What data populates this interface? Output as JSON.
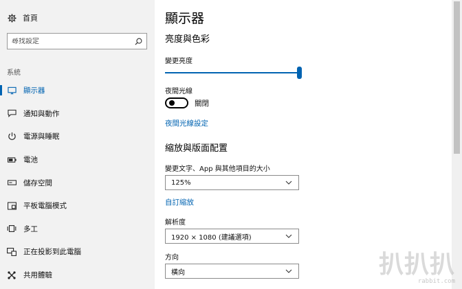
{
  "sidebar": {
    "home_label": "首頁",
    "search_placeholder": "尋找設定",
    "section_label": "系統",
    "items": [
      {
        "label": "顯示器",
        "icon": "monitor-icon",
        "active": true
      },
      {
        "label": "通知與動作",
        "icon": "notification-icon"
      },
      {
        "label": "電源與睡眠",
        "icon": "power-icon"
      },
      {
        "label": "電池",
        "icon": "battery-icon"
      },
      {
        "label": "儲存空間",
        "icon": "storage-icon"
      },
      {
        "label": "平板電腦模式",
        "icon": "tablet-mode-icon"
      },
      {
        "label": "多工",
        "icon": "multitasking-icon"
      },
      {
        "label": "正在投影到此電腦",
        "icon": "projecting-icon"
      },
      {
        "label": "共用體驗",
        "icon": "shared-experiences-icon"
      }
    ]
  },
  "main": {
    "title": "顯示器",
    "brightness_section": "亮度與色彩",
    "brightness_label": "變更亮度",
    "brightness_level": 1.0,
    "night_light_label": "夜間光線",
    "night_light_state": "關閉",
    "night_light_settings_link": "夜間光線設定",
    "scale_section": "縮放與版面配置",
    "text_size_label": "變更文字、App 與其他項目的大小",
    "text_size_value": "125%",
    "custom_scaling_link": "自訂縮放",
    "resolution_label": "解析度",
    "resolution_value": "1920 × 1080 (建議選項)",
    "orientation_label": "方向",
    "orientation_value": "橫向"
  },
  "watermark": {
    "logo_text": "扒扒扒",
    "site": "rabbit.com"
  },
  "colors": {
    "accent": "#0063b1",
    "sidebar_bg": "#f2f2f2"
  }
}
